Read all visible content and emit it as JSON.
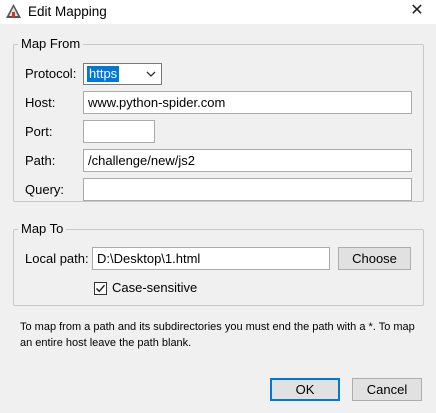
{
  "window": {
    "title": "Edit Mapping",
    "close_glyph": "✕",
    "app_icon": "charles-app-icon",
    "close_icon": "close-icon"
  },
  "map_from": {
    "legend": "Map From",
    "protocol": {
      "label": "Protocol:",
      "value": "https"
    },
    "host": {
      "label": "Host:",
      "value": "www.python-spider.com"
    },
    "port": {
      "label": "Port:",
      "value": ""
    },
    "path": {
      "label": "Path:",
      "value": "/challenge/new/js2"
    },
    "query": {
      "label": "Query:",
      "value": ""
    }
  },
  "map_to": {
    "legend": "Map To",
    "local_path": {
      "label": "Local path:",
      "value": "D:\\Desktop\\1.html"
    },
    "choose_label": "Choose",
    "case_sensitive": {
      "label": "Case-sensitive",
      "checked": true
    }
  },
  "note": "To map from a path and its subdirectories you must end the path with a *. To map an entire host leave the path blank.",
  "buttons": {
    "ok": "OK",
    "cancel": "Cancel"
  },
  "colors": {
    "accent": "#0078d7",
    "background": "#f0f0f0"
  }
}
